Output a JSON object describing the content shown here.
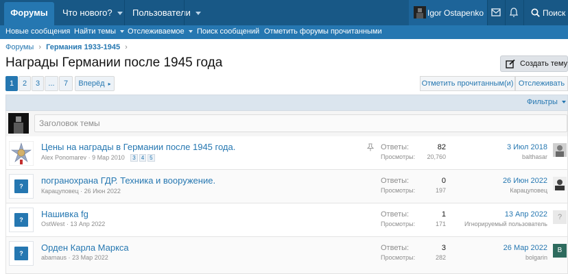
{
  "topnav": {
    "forums": "Форумы",
    "whats_new": "Что нового?",
    "members": "Пользователи",
    "username": "Igor Ostapenko",
    "search": "Поиск"
  },
  "subnav": {
    "new_posts": "Новые сообщения",
    "find_threads": "Найти темы",
    "watched": "Отслеживаемое",
    "search_posts": "Поиск сообщений",
    "mark_read": "Отметить форумы прочитанными"
  },
  "breadcrumb": {
    "root": "Форумы",
    "parent": "Германия 1933-1945"
  },
  "page_title": "Награды Германии после 1945 года",
  "create_thread": "Создать тему",
  "pagination": {
    "pages": [
      "1",
      "2",
      "3",
      "...",
      "7"
    ],
    "next": "Вперёд"
  },
  "actions": {
    "mark_read": "Отметить прочитанным(и)",
    "watch": "Отслеживать"
  },
  "filters_label": "Фильтры",
  "quick_thread_placeholder": "Заголовок темы",
  "labels": {
    "replies": "Ответы:",
    "views": "Просмотры:"
  },
  "threads": [
    {
      "title": "Цены на награды в Германии после 1945 года.",
      "author": "Alex Ponomarev",
      "date": "9 Мар 2010",
      "mini_pages": [
        "3",
        "4",
        "5"
      ],
      "replies": "82",
      "views": "20,760",
      "last_date": "3 Июл 2018",
      "last_user": "balthasar",
      "pinned": true
    },
    {
      "title": "погранохрана ГДР. Техника и вооружение.",
      "author": "Карацуповец",
      "date": "26 Июн 2022",
      "replies": "0",
      "views": "197",
      "last_date": "26 Июн 2022",
      "last_user": "Карацуповец"
    },
    {
      "title": "Нашивка fg",
      "author": "OstWest",
      "date": "13 Апр 2022",
      "replies": "1",
      "views": "171",
      "last_date": "13 Апр 2022",
      "last_user": "Игнорируемый пользователь",
      "last_avatar_letter": "?"
    },
    {
      "title": "Орден Карла Маркса",
      "author": "abamaus",
      "date": "23 Мар 2022",
      "replies": "3",
      "views": "282",
      "last_date": "26 Мар 2022",
      "last_user": "bolgarin",
      "last_avatar_letter": "B"
    }
  ],
  "placeholder_avatar_letter": "?",
  "colors": {
    "header": "#185886",
    "subnav": "#2577b1",
    "link": "#2577b1"
  }
}
